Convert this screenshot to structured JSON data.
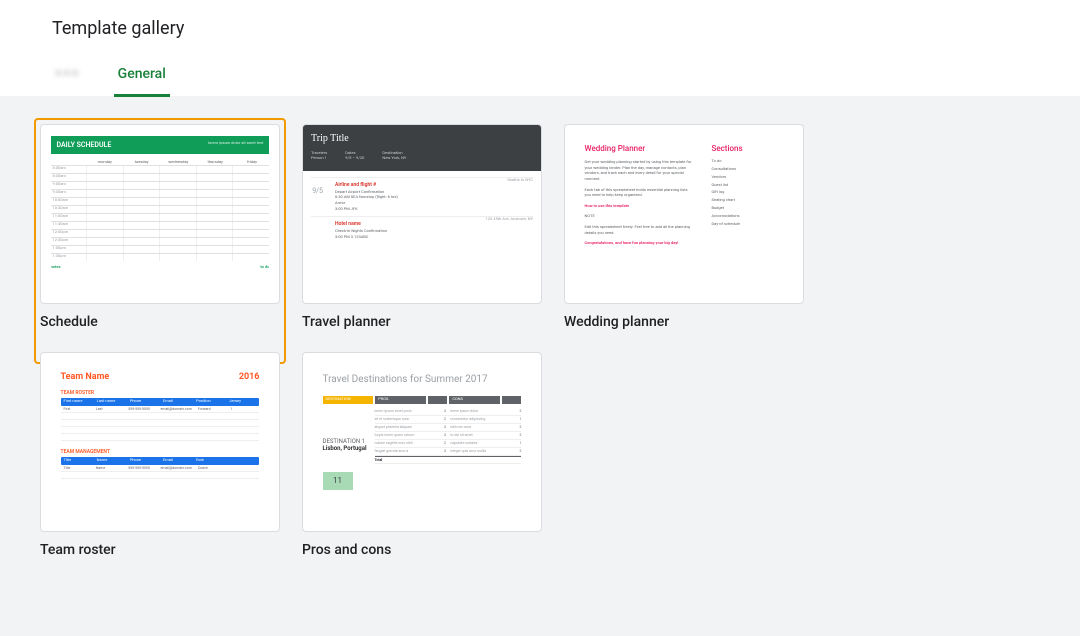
{
  "header": {
    "title": "Template gallery"
  },
  "tabs": [
    {
      "id": "org",
      "label": "•  • •",
      "active": false,
      "blurred": true
    },
    {
      "id": "general",
      "label": "General",
      "active": true,
      "blurred": false
    }
  ],
  "templates": [
    {
      "id": "schedule",
      "label": "Schedule",
      "highlighted": true,
      "preview": {
        "banner_title": "DAILY SCHEDULE",
        "banner_right": "lorem ipsum dolor sit amet text",
        "columns": [
          "",
          "monday",
          "tuesday",
          "wednesday",
          "thursday",
          "friday"
        ],
        "footer_left": "notes",
        "footer_right": "to do"
      }
    },
    {
      "id": "travel",
      "label": "Travel planner",
      "highlighted": false,
      "preview": {
        "title": "Trip Title",
        "meta": [
          {
            "k": "Travelers",
            "v": "Person 1"
          },
          {
            "k": "Dates",
            "v": "9/5 – 9/20"
          },
          {
            "k": "Destination",
            "v": "New York, NY"
          }
        ],
        "date": "9/5",
        "airline_label": "Airline and flight #",
        "airline_right": "Seattle to NYC",
        "airline_rows": [
          "Depart  Airport  Confirmation",
          "6:30 AM  SEA  Nonstop (flight: 6 hrs)",
          "Arrive",
          "3:00 PM  JFK"
        ],
        "hotel_label": "Hotel name",
        "hotel_right": "123 45th Ave, Anytown, NY",
        "hotel_rows": [
          "Check-in  Nights  Confirmation",
          "3:00 PM  3  123ABC"
        ]
      }
    },
    {
      "id": "wedding",
      "label": "Wedding planner",
      "highlighted": false,
      "preview": {
        "title": "Wedding Planner",
        "sections_title": "Sections",
        "paragraphs": [
          "Get your wedding planning started by using this template for your wedding binder. Plan the day, manage contacts, plan vendors, and track each and every detail for your special moment.",
          "Each tab of this spreadsheet holds essential planning lists you need to help keep organized.",
          "NOTE"
        ],
        "pink_lines": [
          "How to use this template",
          "Congratulations, and have fun planning your big day!"
        ],
        "sections": [
          "To do",
          "Consultations",
          "Vendors",
          "Guest list",
          "Gift log",
          "Seating chart",
          "Budget",
          "Accomodations",
          "Day-of schedule"
        ]
      }
    },
    {
      "id": "roster",
      "label": "Team roster",
      "highlighted": false,
      "preview": {
        "team": "Team Name",
        "year": "2016",
        "section1": "TEAM ROSTER",
        "headers1": [
          "First name",
          "Last name",
          "Phone",
          "Email",
          "Position",
          "Jersey"
        ],
        "row1": [
          "First",
          "Last",
          "555-555-5555",
          "email@domain.com",
          "Forward",
          "1"
        ],
        "section2": "TEAM MANAGEMENT",
        "headers2": [
          "Title",
          "Name",
          "Phone",
          "Email",
          "Role",
          ""
        ],
        "row2": [
          "Title",
          "Name",
          "555-555-5555",
          "email@domain.com",
          "Coach",
          ""
        ]
      }
    },
    {
      "id": "proscons",
      "label": "Pros and cons",
      "highlighted": false,
      "preview": {
        "title": "Travel Destinations for Summer 2017",
        "col_headers": [
          "DESTINATION",
          "PROS",
          "",
          "CONS",
          ""
        ],
        "city_label": "DESTINATION 1",
        "city": "Lisbon, Portugal",
        "score": "11",
        "rows": 6,
        "total_label": "Total"
      }
    }
  ]
}
